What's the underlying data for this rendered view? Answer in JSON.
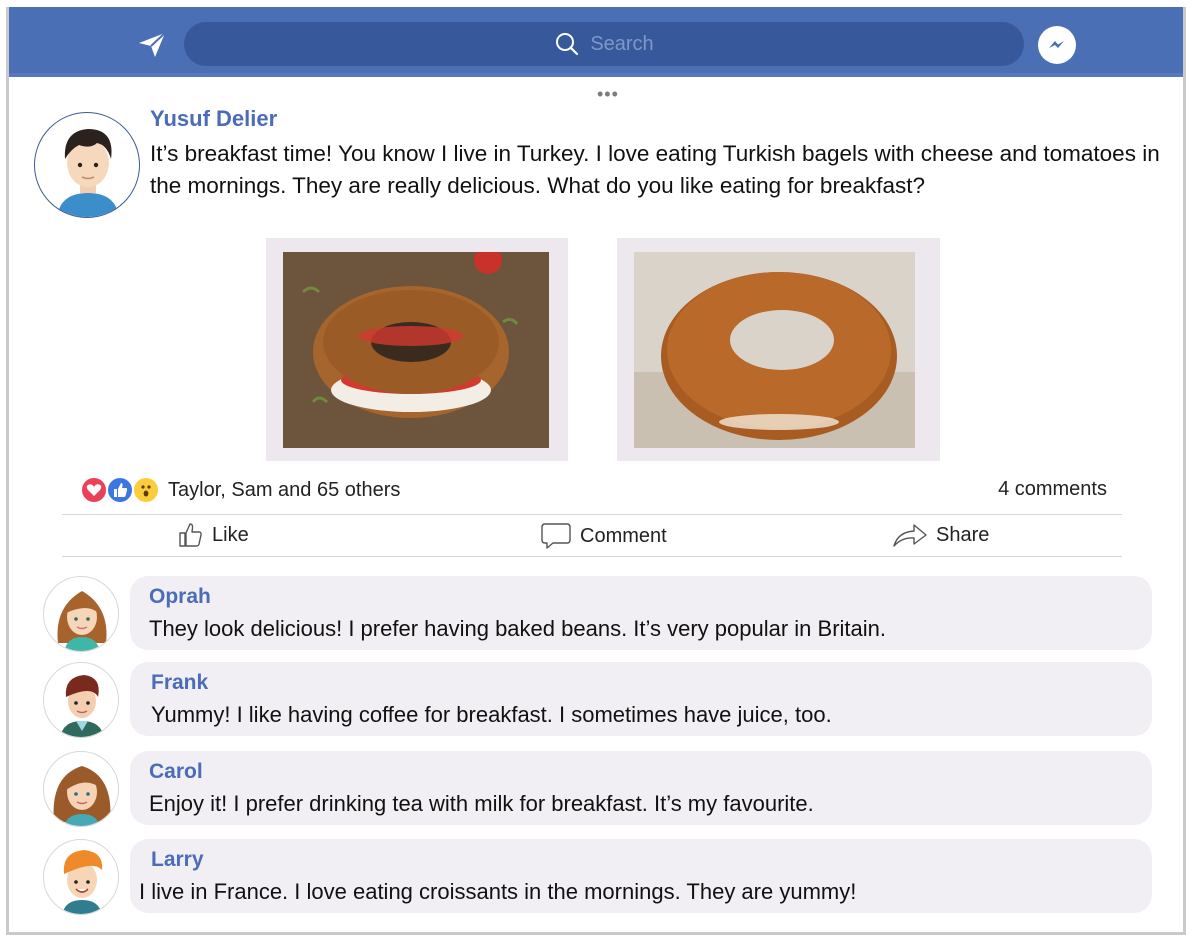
{
  "topbar": {
    "search_placeholder": "Search",
    "color": "#4a6fb5",
    "icons": [
      "send-icon",
      "search-icon",
      "messenger-icon"
    ]
  },
  "post": {
    "more_label": "•••",
    "author": "Yusuf Delier",
    "text": "It’s breakfast time! You know I live in Turkey. I love eating Turkish bagels with cheese and tomatoes in the mornings. They are really delicious. What do you like eating for breakfast?",
    "reactions_label": "Taylor, Sam and 65 others",
    "comments_label": "4 comments",
    "actions": {
      "like": "Like",
      "comment": "Comment",
      "share": "Share"
    }
  },
  "comments": [
    {
      "name": "Oprah",
      "text": "They look delicious! I prefer having baked beans. It’s very popular in Britain."
    },
    {
      "name": "Frank",
      "text": "Yummy! I like having coffee for breakfast. I sometimes have juice, too."
    },
    {
      "name": "Carol",
      "text": "Enjoy it! I prefer drinking tea with milk for breakfast. It’s my favourite."
    },
    {
      "name": "Larry",
      "text": "I live in France. I love eating croissants in the mornings. They are yummy!"
    }
  ]
}
